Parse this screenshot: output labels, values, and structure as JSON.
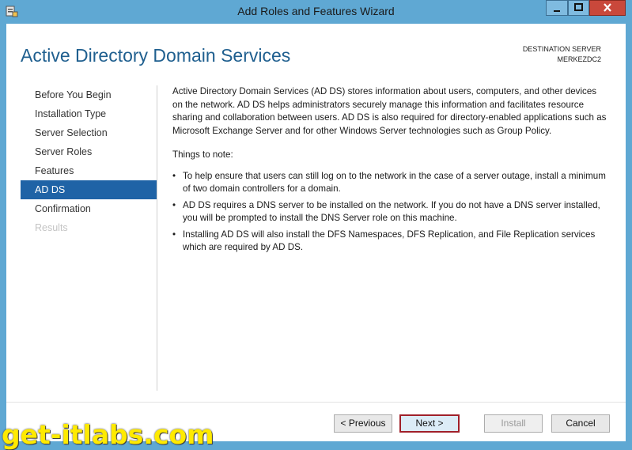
{
  "window": {
    "title": "Add Roles and Features Wizard"
  },
  "header": {
    "page_title": "Active Directory Domain Services",
    "destination_label": "DESTINATION SERVER",
    "destination_server": "MERKEZDC2"
  },
  "nav": {
    "items": [
      {
        "label": "Before You Begin",
        "state": "normal"
      },
      {
        "label": "Installation Type",
        "state": "normal"
      },
      {
        "label": "Server Selection",
        "state": "normal"
      },
      {
        "label": "Server Roles",
        "state": "normal"
      },
      {
        "label": "Features",
        "state": "normal"
      },
      {
        "label": "AD DS",
        "state": "active"
      },
      {
        "label": "Confirmation",
        "state": "normal"
      },
      {
        "label": "Results",
        "state": "disabled"
      }
    ]
  },
  "content": {
    "intro": "Active Directory Domain Services (AD DS) stores information about users, computers, and other devices on the network.  AD DS helps administrators securely manage this information and facilitates resource sharing and collaboration between users.  AD DS is also required for directory-enabled applications such as Microsoft Exchange Server and for other Windows Server technologies such as Group Policy.",
    "notes_heading": "Things to note:",
    "notes": [
      "To help ensure that users can still log on to the network in the case of a server outage, install a minimum of two domain controllers for a domain.",
      "AD DS requires a DNS server to be installed on the network.  If you do not have a DNS server installed, you will be prompted to install the DNS Server role on this machine.",
      "Installing AD DS will also install the DFS Namespaces, DFS Replication, and File Replication services which are required by AD DS."
    ]
  },
  "buttons": {
    "previous": "< Previous",
    "next": "Next >",
    "install": "Install",
    "cancel": "Cancel"
  },
  "watermark": "get-itlabs.com",
  "colors": {
    "frame": "#5fa8d3",
    "active_nav": "#1f63a6",
    "title": "#1f5f8f",
    "next_highlight": "#a0202a",
    "watermark": "#ffea00"
  }
}
